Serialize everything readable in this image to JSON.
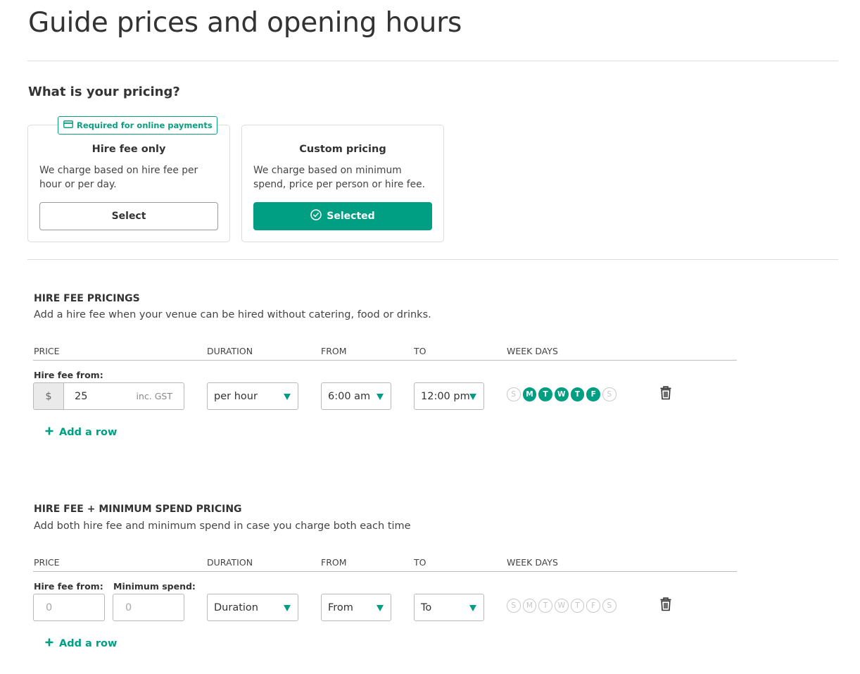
{
  "page": {
    "title": "Guide prices and opening hours"
  },
  "pricing": {
    "question": "What is your pricing?",
    "required_badge": "Required for online payments",
    "options": [
      {
        "title": "Hire fee only",
        "description": "We charge based on hire fee per hour or per day.",
        "button": "Select",
        "selected": false
      },
      {
        "title": "Custom pricing",
        "description": "We charge based on minimum spend, price per person or hire fee.",
        "button": "Selected",
        "selected": true
      }
    ]
  },
  "columns": {
    "price": "PRICE",
    "duration": "DURATION",
    "from": "FROM",
    "to": "TO",
    "weekdays": "WEEK DAYS"
  },
  "hire_fee": {
    "title": "HIRE FEE PRICINGS",
    "subtitle": "Add a hire fee when your venue can be hired without catering, food or drinks.",
    "row": {
      "label": "Hire fee from:",
      "currency": "$",
      "value": "25",
      "suffix": "inc. GST",
      "duration": "per hour",
      "from": "6:00 am",
      "to": "12:00 pm",
      "days": [
        {
          "letter": "S",
          "on": false
        },
        {
          "letter": "M",
          "on": true
        },
        {
          "letter": "T",
          "on": true
        },
        {
          "letter": "W",
          "on": true
        },
        {
          "letter": "T",
          "on": true
        },
        {
          "letter": "F",
          "on": true
        },
        {
          "letter": "S",
          "on": false
        }
      ]
    },
    "add_row": "Add a row"
  },
  "hire_min": {
    "title": "HIRE FEE + MINIMUM SPEND PRICING",
    "subtitle": "Add both hire fee and minimum spend in case you charge both each time",
    "row": {
      "hire_label": "Hire fee from:",
      "min_label": "Minimum spend:",
      "hire_placeholder": "0",
      "min_placeholder": "0",
      "duration": "Duration",
      "from": "From",
      "to": "To",
      "days": [
        {
          "letter": "S",
          "on": false
        },
        {
          "letter": "M",
          "on": false
        },
        {
          "letter": "T",
          "on": false
        },
        {
          "letter": "W",
          "on": false
        },
        {
          "letter": "T",
          "on": false
        },
        {
          "letter": "F",
          "on": false
        },
        {
          "letter": "S",
          "on": false
        }
      ]
    },
    "add_row": "Add a row"
  },
  "colors": {
    "accent": "#009f83",
    "border": "#b8b8b8",
    "text": "#333333"
  }
}
